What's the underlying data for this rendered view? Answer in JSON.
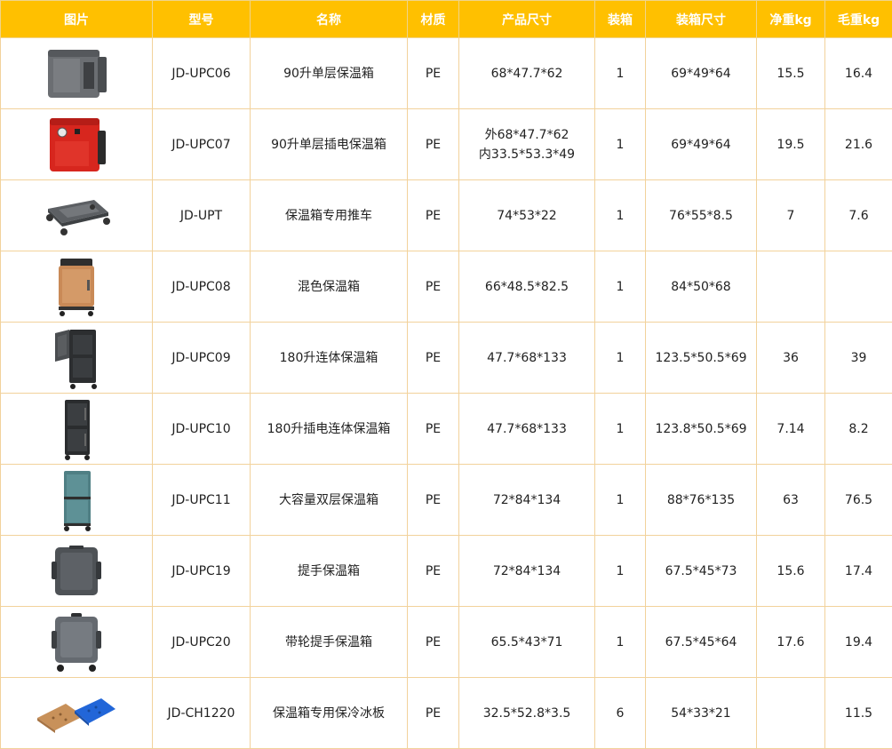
{
  "table": {
    "headers": [
      "图片",
      "型号",
      "名称",
      "材质",
      "产品尺寸",
      "装箱",
      "装箱尺寸",
      "净重kg",
      "毛重kg"
    ],
    "rows": [
      {
        "image_icon": "gray-food-carrier-icon",
        "model": "JD-UPC06",
        "name": "90升单层保温箱",
        "material": "PE",
        "size": "68*47.7*62",
        "pack": "1",
        "carton_size": "69*49*64",
        "net_weight": "15.5",
        "gross_weight": "16.4"
      },
      {
        "image_icon": "red-electric-food-carrier-icon",
        "model": "JD-UPC07",
        "name": "90升单层插电保温箱",
        "material": "PE",
        "size_outer": "外68*47.7*62",
        "size_inner": "内33.5*53.3*49",
        "pack": "1",
        "carton_size": "69*49*64",
        "net_weight": "19.5",
        "gross_weight": "21.6"
      },
      {
        "image_icon": "dolly-cart-icon",
        "model": "JD-UPT",
        "name": "保温箱专用推车",
        "material": "PE",
        "size": "74*53*22",
        "pack": "1",
        "carton_size": "76*55*8.5",
        "net_weight": "7",
        "gross_weight": "7.6"
      },
      {
        "image_icon": "tan-cabinet-carrier-icon",
        "model": "JD-UPC08",
        "name": "混色保温箱",
        "material": "PE",
        "size": "66*48.5*82.5",
        "pack": "1",
        "carton_size": "84*50*68",
        "net_weight": "",
        "gross_weight": ""
      },
      {
        "image_icon": "black-open-door-cabinet-icon",
        "model": "JD-UPC09",
        "name": "180升连体保温箱",
        "material": "PE",
        "size": "47.7*68*133",
        "pack": "1",
        "carton_size": "123.5*50.5*69",
        "net_weight": "36",
        "gross_weight": "39"
      },
      {
        "image_icon": "black-double-door-cabinet-icon",
        "model": "JD-UPC10",
        "name": "180升插电连体保温箱",
        "material": "PE",
        "size": "47.7*68*133",
        "pack": "1",
        "carton_size": "123.8*50.5*69",
        "net_weight": "7.14",
        "gross_weight": "8.2"
      },
      {
        "image_icon": "teal-double-door-cabinet-icon",
        "model": "JD-UPC11",
        "name": "大容量双层保温箱",
        "material": "PE",
        "size": "72*84*134",
        "pack": "1",
        "carton_size": "88*76*135",
        "net_weight": "63",
        "gross_weight": "76.5"
      },
      {
        "image_icon": "gray-handle-carrier-icon",
        "model": "JD-UPC19",
        "name": "提手保温箱",
        "material": "PE",
        "size": "72*84*134",
        "pack": "1",
        "carton_size": "67.5*45*73",
        "net_weight": "15.6",
        "gross_weight": "17.4"
      },
      {
        "image_icon": "gray-wheeled-handle-carrier-icon",
        "model": "JD-UPC20",
        "name": "带轮提手保温箱",
        "material": "PE",
        "size": "65.5*43*71",
        "pack": "1",
        "carton_size": "67.5*45*64",
        "net_weight": "17.6",
        "gross_weight": "19.4"
      },
      {
        "image_icon": "ice-plates-icon",
        "model": "JD-CH1220",
        "name": "保温箱专用保冷冰板",
        "material": "PE",
        "size": "32.5*52.8*3.5",
        "pack": "6",
        "carton_size": "54*33*21",
        "net_weight": "",
        "gross_weight": "11.5"
      }
    ]
  },
  "colors": {
    "header_bg": "#ffc000",
    "header_text": "#ffffff",
    "border": "#f2d29b"
  }
}
